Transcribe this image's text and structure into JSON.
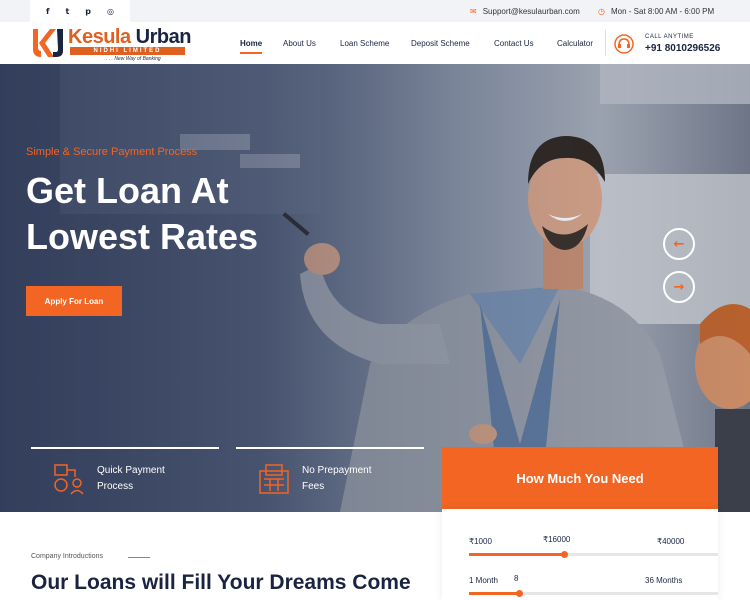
{
  "topbar": {
    "social": [
      {
        "icon": "facebook-icon",
        "glyph": "f"
      },
      {
        "icon": "twitter-icon",
        "glyph": "t"
      },
      {
        "icon": "pinterest-icon",
        "glyph": "p"
      },
      {
        "icon": "instagram-icon",
        "glyph": "◎"
      }
    ],
    "email": "Support@kesulaurban.com",
    "hours": "Mon - Sat 8:00 AM - 6:00 PM"
  },
  "brand": {
    "name_part1": "Kesula",
    "name_part2": "Urban",
    "subtitle": "NIDHI LIMITED",
    "tagline": ". . . New Way of Banking",
    "accent": "#f26522",
    "navy": "#1a2440"
  },
  "nav": {
    "items": [
      "Home",
      "About Us",
      "Loan Scheme",
      "Deposit Scheme",
      "Contact Us",
      "Calculator"
    ],
    "active": "Home"
  },
  "call": {
    "label": "CALL ANYTIME",
    "number": "+91 8010296526"
  },
  "hero": {
    "tagline": "Simple & Secure Payment Process",
    "title": "Get Loan At Lowest Rates",
    "cta": "Apply For Loan",
    "prev_glyph": "←",
    "next_glyph": "→"
  },
  "features": [
    {
      "label": "Quick Payment Process",
      "icon": "payment-process-icon"
    },
    {
      "label": "No Prepayment Fees",
      "icon": "calculator-fees-icon"
    }
  ],
  "calculator": {
    "title": "How Much You Need",
    "amount": {
      "min": "₹1000",
      "value": "₹16000",
      "max": "₹40000",
      "level": 0.38
    },
    "duration": {
      "min": "1 Month",
      "value": "8",
      "max": "36 Months",
      "level": 0.2
    }
  },
  "about": {
    "label": "Company Introductions",
    "heading": "Our Loans will Fill Your Dreams Come"
  }
}
